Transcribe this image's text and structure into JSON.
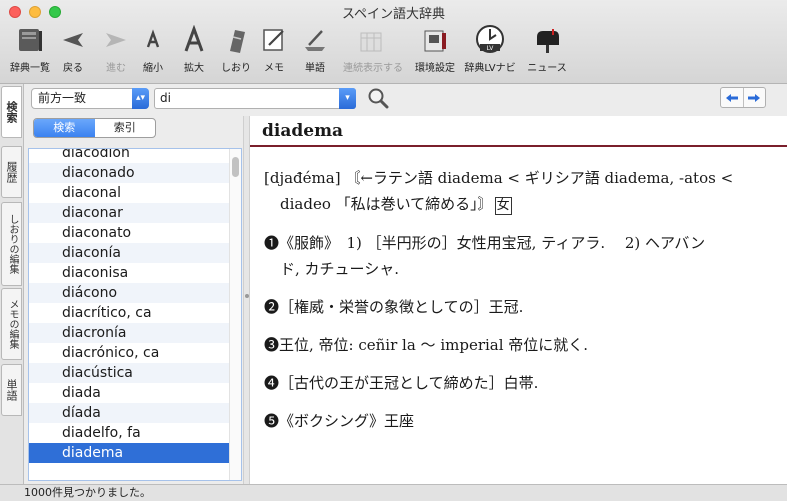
{
  "window": {
    "title": "スペイン語大辞典",
    "width": 787,
    "height": 501
  },
  "colors": {
    "selection": "#2f6fd7",
    "accent": "#7a1f2b",
    "segment_active": "#3b82f0",
    "nav_arrow": "#2a6bd8"
  },
  "toolbar": {
    "buttons": [
      {
        "label": "辞典一覧",
        "icon": "book-stack-icon",
        "enabled": true
      },
      {
        "label": "戻る",
        "icon": "back-arrow-icon",
        "enabled": true
      },
      {
        "label": "進む",
        "icon": "forward-arrow-icon",
        "enabled": false
      },
      {
        "label": "縮小",
        "icon": "shrink-text-icon",
        "enabled": true
      },
      {
        "label": "拡大",
        "icon": "enlarge-text-icon",
        "enabled": true
      },
      {
        "label": "しおり",
        "icon": "bookmark-icon",
        "enabled": true
      },
      {
        "label": "メモ",
        "icon": "memo-icon",
        "enabled": true
      },
      {
        "label": "単語",
        "icon": "word-icon",
        "enabled": true
      },
      {
        "label": "連続表示する",
        "icon": "continuous-display-icon",
        "enabled": false
      },
      {
        "label": "環境設定",
        "icon": "preferences-icon",
        "enabled": true
      },
      {
        "label": "辞典LVナビ",
        "icon": "lv-navi-icon",
        "enabled": true
      },
      {
        "label": "ニュース",
        "icon": "news-mailbox-icon",
        "enabled": true
      }
    ]
  },
  "search": {
    "mode": "前方一致",
    "query": "di"
  },
  "side_tabs": [
    "検",
    "索",
    "履",
    "歴",
    "しおりの編集",
    "メモの編集",
    "単",
    "語"
  ],
  "segment": {
    "search": "検索",
    "index": "索引"
  },
  "word_list": [
    "diacodión",
    "diaconado",
    "diaconal",
    "diaconar",
    "diaconato",
    "diaconía",
    "diaconisa",
    "diácono",
    "diacrítico, ca",
    "diacronía",
    "diacrónico, ca",
    "diacústica",
    "diada",
    "díada",
    "diadelfo, fa",
    "diadema"
  ],
  "selected_word": "diadema",
  "entry": {
    "headword": "diadema",
    "etymology_line1": "[djađéma] 〘←ラテン語 diadema < ギリシア語 diadema, -atos <",
    "etymology_line2": "diadeo 「私は巻いて締める」〙",
    "gender": "女",
    "senses": [
      {
        "num": "❶",
        "text_line1": "《服飾》　1) ［半円形の］女性用宝冠, ティアラ.　 2) ヘアバン",
        "text_line2": "ド, カチューシャ."
      },
      {
        "num": "❷",
        "text_line1": "［権威・栄誉の象徴としての］王冠.",
        "text_line2": ""
      },
      {
        "num": "❸",
        "text_line1": "王位, 帝位: ceñir la 〜 imperial 帝位に就く.",
        "text_line2": ""
      },
      {
        "num": "❹",
        "text_line1": "［古代の王が王冠として締めた］白帯.",
        "text_line2": ""
      },
      {
        "num": "❺",
        "text_line1": "《ボクシング》王座",
        "text_line2": ""
      }
    ]
  },
  "status": "1000件見つかりました。"
}
